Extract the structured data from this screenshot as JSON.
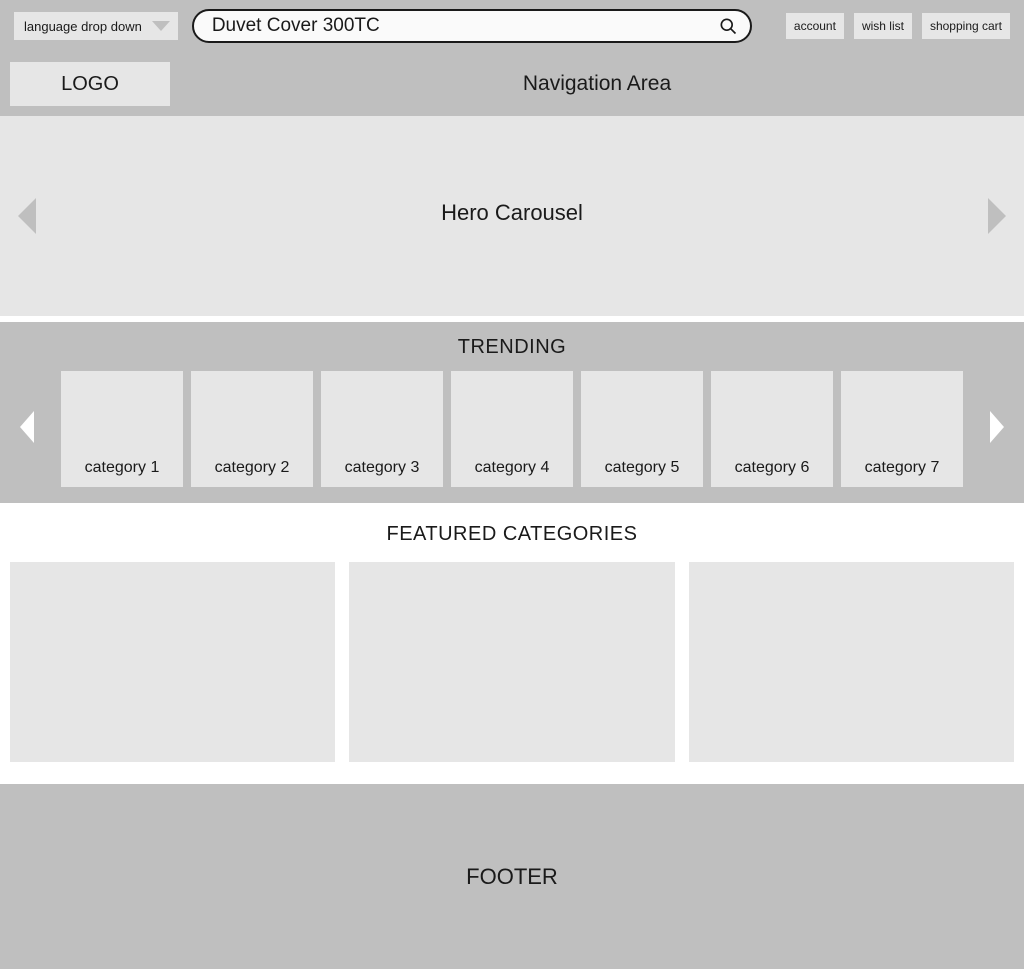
{
  "topbar": {
    "language_label": "language drop down",
    "search_value": "Duvet Cover 300TC",
    "account_label": "account",
    "wishlist_label": "wish list",
    "cart_label": "shopping cart"
  },
  "header": {
    "logo_text": "LOGO",
    "nav_label": "Navigation Area"
  },
  "hero": {
    "title": "Hero Carousel"
  },
  "trending": {
    "title": "TRENDING",
    "items": [
      {
        "label": "category 1"
      },
      {
        "label": "category 2"
      },
      {
        "label": "category 3"
      },
      {
        "label": "category 4"
      },
      {
        "label": "category 5"
      },
      {
        "label": "category 6"
      },
      {
        "label": "category 7"
      }
    ]
  },
  "featured": {
    "title": "FEATURED CATEGORIES"
  },
  "footer": {
    "label": "FOOTER"
  }
}
